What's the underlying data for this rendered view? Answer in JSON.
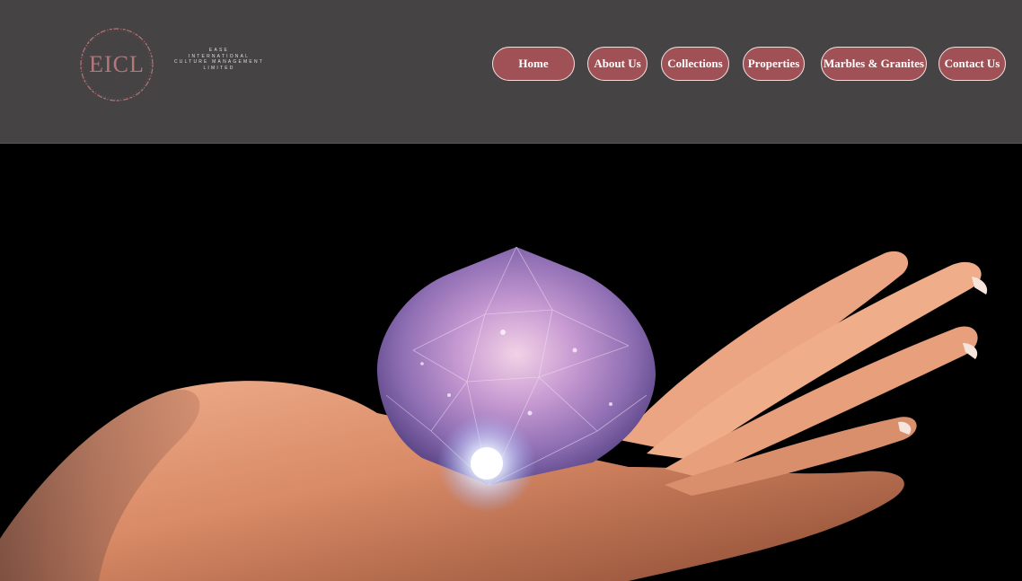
{
  "brand": {
    "logo_mark": "EICL",
    "logo_lines": [
      "EASE",
      "INTERNATIONAL",
      "CULTURE MANAGEMENT",
      "LIMITED"
    ],
    "accent_color": "#a05156",
    "header_color": "#454344"
  },
  "nav": {
    "items": [
      {
        "label": "Home"
      },
      {
        "label": "About Us"
      },
      {
        "label": "Collections"
      },
      {
        "label": "Properties"
      },
      {
        "label": "Marbles & Granites"
      },
      {
        "label": "Contact Us"
      }
    ]
  },
  "hero": {
    "image_icon": "diamond-in-hand-image"
  }
}
